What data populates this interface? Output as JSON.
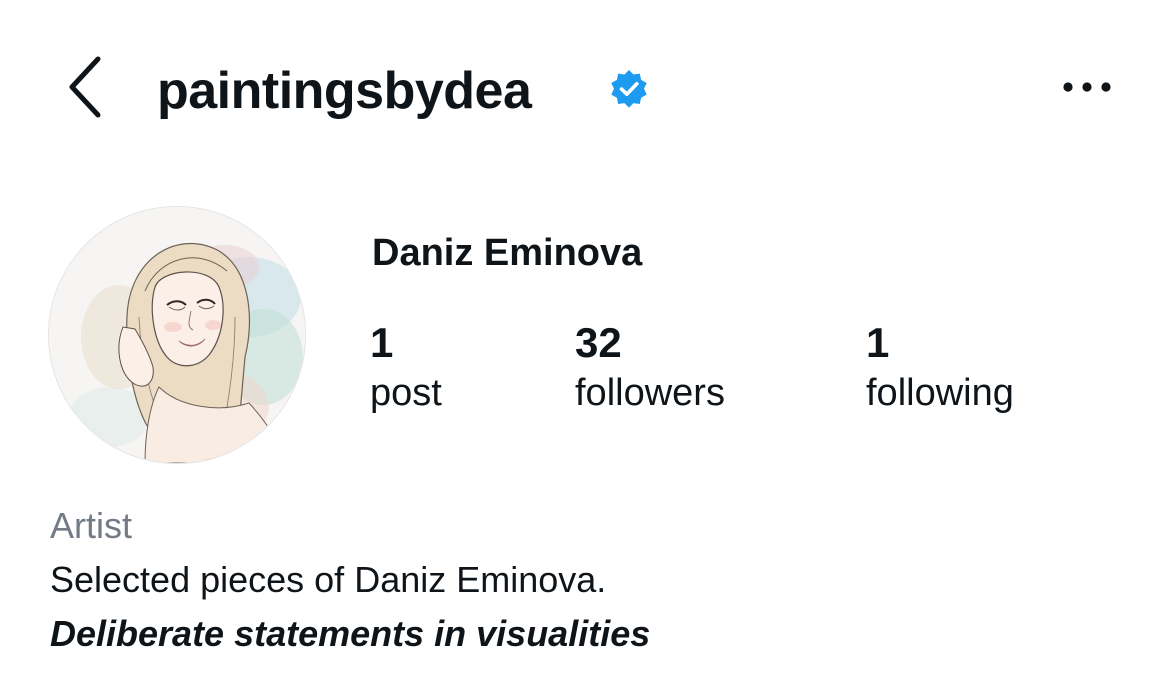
{
  "header": {
    "back_icon": "chevron-left-icon",
    "username": "paintingsbydea",
    "verified_icon": "verified-badge-icon",
    "more_icon": "more-horizontal-icon"
  },
  "profile": {
    "avatar": "illustrated-portrait-avatar",
    "display_name": "Daniz Eminova",
    "stats": {
      "posts": {
        "count": "1",
        "label": "post"
      },
      "followers": {
        "count": "32",
        "label": "followers"
      },
      "following": {
        "count": "1",
        "label": "following"
      }
    }
  },
  "bio": {
    "category": "Artist",
    "line1": "Selected pieces of Daniz Eminova.",
    "line2": "Deliberate statements in visualities"
  },
  "colors": {
    "text": "#0f1419",
    "verified": "#1d9bf0",
    "category": "#737b86"
  }
}
